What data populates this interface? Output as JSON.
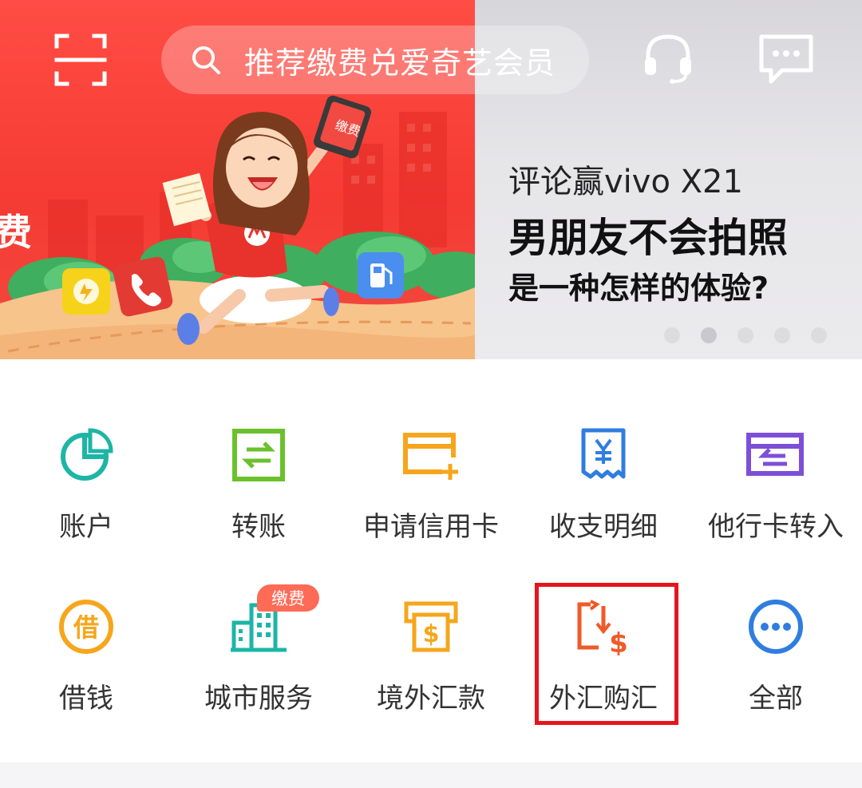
{
  "header": {
    "search_placeholder": "推荐缴费兑爱奇艺会员"
  },
  "banner": {
    "left_slide": {
      "cut_text": "费",
      "phone_sign": "缴费"
    },
    "right_slide": {
      "line1": "评论赢vivo X21",
      "line2": "男朋友不会拍照",
      "line3": "是一种怎样的体验?"
    },
    "page_dots": {
      "count": 5,
      "active_index": 1
    }
  },
  "quick_actions": {
    "row1": [
      {
        "label": "账户",
        "icon": "pie-chart-icon",
        "color": "#1db5a5"
      },
      {
        "label": "转账",
        "icon": "transfer-icon",
        "color": "#6bc12c"
      },
      {
        "label": "申请信用卡",
        "icon": "credit-card-add-icon",
        "color": "#f6a61c"
      },
      {
        "label": "收支明细",
        "icon": "receipt-icon",
        "color": "#2f7de0"
      },
      {
        "label": "他行卡转入",
        "icon": "card-transfer-in-icon",
        "color": "#7d4fd6"
      }
    ],
    "row2": [
      {
        "label": "借钱",
        "icon": "borrow-icon",
        "color": "#f6a61c"
      },
      {
        "label": "城市服务",
        "icon": "city-buildings-icon",
        "color": "#1db5a5",
        "badge": "缴费"
      },
      {
        "label": "境外汇款",
        "icon": "remittance-icon",
        "color": "#f6a61c"
      },
      {
        "label": "外汇购汇",
        "icon": "forex-exchange-icon",
        "color": "#f05a28"
      },
      {
        "label": "全部",
        "icon": "more-icon",
        "color": "#2f7de0"
      }
    ]
  },
  "highlighted_item": "外汇购汇",
  "colors": {
    "brand_red": "#f53b33",
    "highlight_border": "#e5161b",
    "badge_bg": "#ff6b57"
  }
}
